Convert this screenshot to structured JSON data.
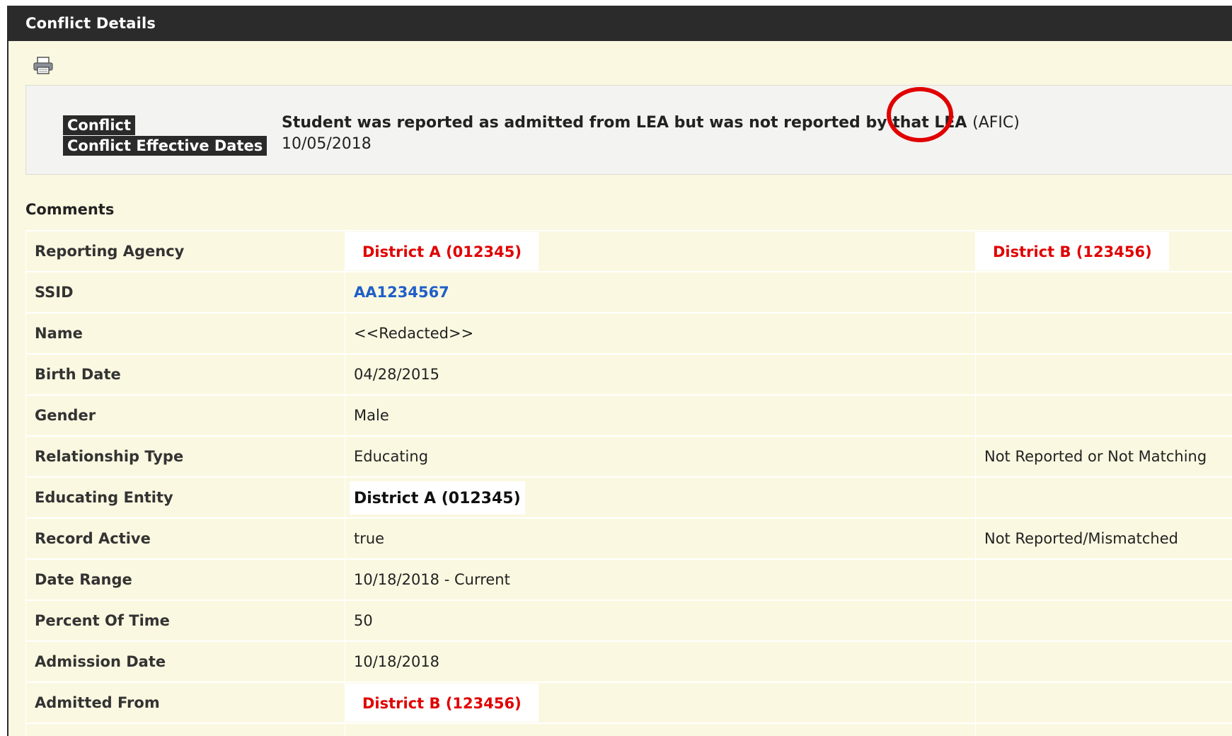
{
  "window": {
    "title": "Conflict Details"
  },
  "icons": {
    "print": "printer-icon"
  },
  "conflict": {
    "label": "Conflict",
    "dates_label": "Conflict Effective Dates",
    "description": "Student was reported as admitted from LEA but was not reported by that LEA",
    "code": "(AFIC)",
    "effective_date": "10/05/2018",
    "highlight_color": "#e00000"
  },
  "comments": {
    "heading": "Comments"
  },
  "rows": [
    {
      "label": "Reporting Agency",
      "value": "District A (012345)",
      "other": "District B (123456)"
    },
    {
      "label": "SSID",
      "value": "AA1234567",
      "other": ""
    },
    {
      "label": "Name",
      "value": "<<Redacted>>",
      "other": ""
    },
    {
      "label": "Birth Date",
      "value": "04/28/2015",
      "other": ""
    },
    {
      "label": "Gender",
      "value": "Male",
      "other": ""
    },
    {
      "label": "Relationship Type",
      "value": "Educating",
      "other": "Not Reported or Not Matching"
    },
    {
      "label": "Educating Entity",
      "value": "District A (012345)",
      "other": ""
    },
    {
      "label": "Record Active",
      "value": "true",
      "other": "Not Reported/Mismatched"
    },
    {
      "label": "Date Range",
      "value": "10/18/2018 - Current",
      "other": ""
    },
    {
      "label": "Percent Of Time",
      "value": "50",
      "other": ""
    },
    {
      "label": "Admission Date",
      "value": "10/18/2018",
      "other": ""
    },
    {
      "label": "Admitted From",
      "value": "District B (123456)",
      "other": ""
    }
  ],
  "colors": {
    "titlebar": "#2b2b2b",
    "panel": "#fbf8e1",
    "alert_red": "#e00000",
    "link_blue": "#1f5fc8"
  }
}
